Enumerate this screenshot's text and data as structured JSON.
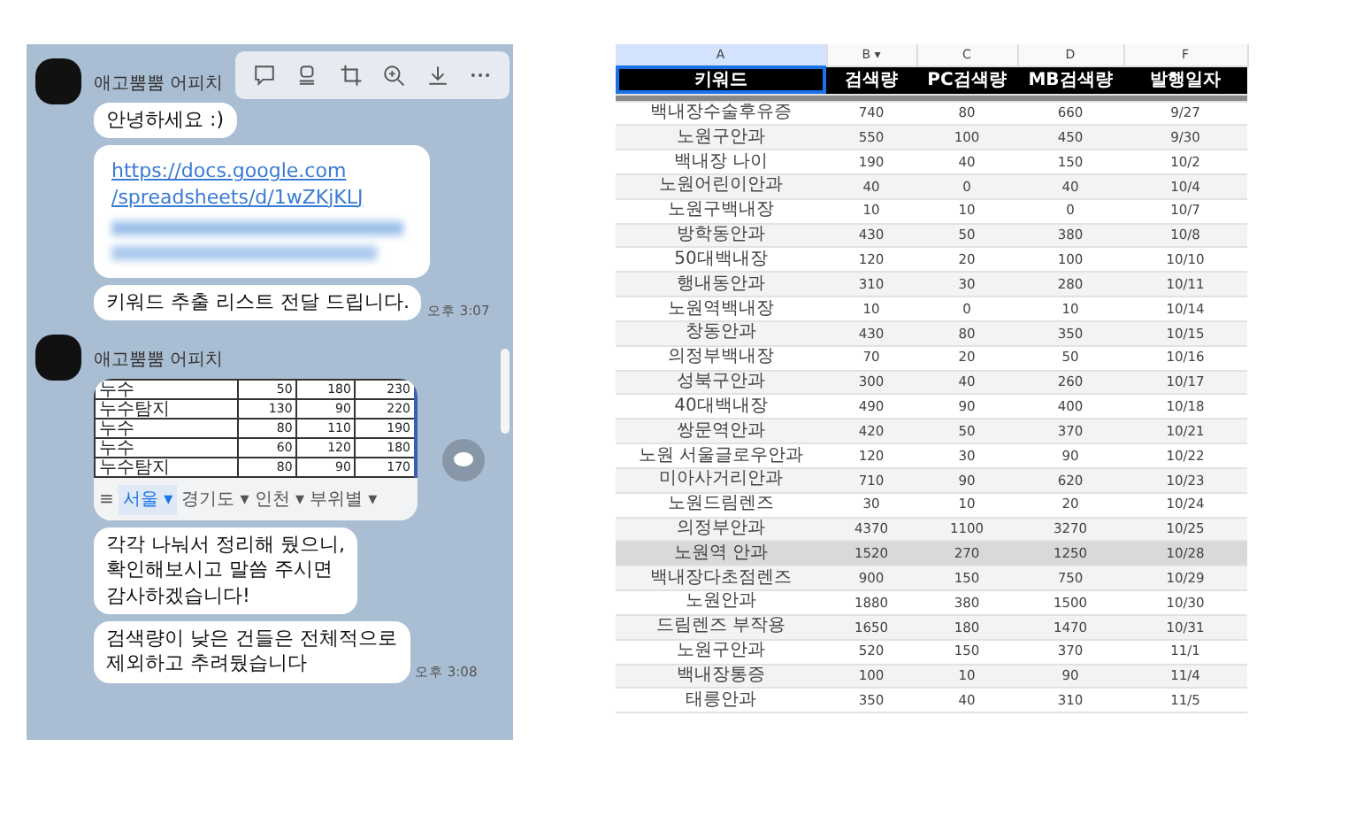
{
  "chat": {
    "groups": [
      {
        "sender": "애고뿜뿜 어피치",
        "items": [
          {
            "kind": "text",
            "text": "안녕하세요 :)"
          },
          {
            "kind": "link",
            "lines": [
              "https://docs.google.com",
              "/spreadsheets/d/1wZKjKLJ"
            ]
          },
          {
            "kind": "text",
            "text": "키워드 추출 리스트 전달 드립니다.",
            "time": "오후 3:07"
          }
        ]
      },
      {
        "sender": "애고뿜뿜 어피치",
        "items": [
          {
            "kind": "image",
            "rows": [
              {
                "cells": [
                  "누수",
                  "50",
                  "180",
                  "230"
                ]
              },
              {
                "cells": [
                  "누수탐지",
                  "130",
                  "90",
                  "220"
                ]
              },
              {
                "cells": [
                  "누수",
                  "80",
                  "110",
                  "190"
                ]
              },
              {
                "cells": [
                  "누수",
                  "60",
                  "120",
                  "180"
                ]
              },
              {
                "cells": [
                  "누수탐지",
                  "80",
                  "90",
                  "170"
                ]
              }
            ],
            "menu": "≡",
            "tabs": [
              {
                "label": "서울 ▾",
                "selected": true
              },
              {
                "label": "경기도 ▾",
                "selected": false
              },
              {
                "label": "인천 ▾",
                "selected": false
              },
              {
                "label": "부위별 ▾",
                "selected": false
              }
            ]
          },
          {
            "kind": "text",
            "text": "각각 나눠서 정리해 뒀으니,\n확인해보시고 말씀 주시면\n감사하겠습니다!"
          },
          {
            "kind": "text",
            "text": "검색량이 낮은 건들은 전체적으로\n제외하고 추려뒀습니다",
            "time": "오후 3:08"
          }
        ]
      }
    ]
  },
  "sheet": {
    "columns": [
      {
        "letter": "A",
        "selected": true
      },
      {
        "letter": "B",
        "selected": false,
        "filter_icon": "▾"
      },
      {
        "letter": "C",
        "selected": false
      },
      {
        "letter": "D",
        "selected": false
      },
      {
        "letter": "F",
        "selected": false
      }
    ],
    "headers": [
      "키워드",
      "검색량",
      "PC검색량",
      "MB검색량",
      "발행일자"
    ],
    "rows": [
      {
        "cells": [
          "백내장수술후유증",
          "740",
          "80",
          "660",
          "9/27"
        ],
        "selected": false
      },
      {
        "cells": [
          "노원구안과",
          "550",
          "100",
          "450",
          "9/30"
        ],
        "selected": false
      },
      {
        "cells": [
          "백내장 나이",
          "190",
          "40",
          "150",
          "10/2"
        ],
        "selected": false
      },
      {
        "cells": [
          "노원어린이안과",
          "40",
          "0",
          "40",
          "10/4"
        ],
        "selected": false
      },
      {
        "cells": [
          "노원구백내장",
          "10",
          "10",
          "0",
          "10/7"
        ],
        "selected": false
      },
      {
        "cells": [
          "방학동안과",
          "430",
          "50",
          "380",
          "10/8"
        ],
        "selected": false
      },
      {
        "cells": [
          "50대백내장",
          "120",
          "20",
          "100",
          "10/10"
        ],
        "selected": false
      },
      {
        "cells": [
          "행내동안과",
          "310",
          "30",
          "280",
          "10/11"
        ],
        "selected": false
      },
      {
        "cells": [
          "노원역백내장",
          "10",
          "0",
          "10",
          "10/14"
        ],
        "selected": false
      },
      {
        "cells": [
          "창동안과",
          "430",
          "80",
          "350",
          "10/15"
        ],
        "selected": false
      },
      {
        "cells": [
          "의정부백내장",
          "70",
          "20",
          "50",
          "10/16"
        ],
        "selected": false
      },
      {
        "cells": [
          "성북구안과",
          "300",
          "40",
          "260",
          "10/17"
        ],
        "selected": false
      },
      {
        "cells": [
          "40대백내장",
          "490",
          "90",
          "400",
          "10/18"
        ],
        "selected": false
      },
      {
        "cells": [
          "쌍문역안과",
          "420",
          "50",
          "370",
          "10/21"
        ],
        "selected": false
      },
      {
        "cells": [
          "노원 서울글로우안과",
          "120",
          "30",
          "90",
          "10/22"
        ],
        "selected": false
      },
      {
        "cells": [
          "미아사거리안과",
          "710",
          "90",
          "620",
          "10/23"
        ],
        "selected": false
      },
      {
        "cells": [
          "노원드림렌즈",
          "30",
          "10",
          "20",
          "10/24"
        ],
        "selected": false
      },
      {
        "cells": [
          "의정부안과",
          "4370",
          "1100",
          "3270",
          "10/25"
        ],
        "selected": false
      },
      {
        "cells": [
          "노원역 안과",
          "1520",
          "270",
          "1250",
          "10/28"
        ],
        "selected": true
      },
      {
        "cells": [
          "백내장다초점렌즈",
          "900",
          "150",
          "750",
          "10/29"
        ],
        "selected": false
      },
      {
        "cells": [
          "노원안과",
          "1880",
          "380",
          "1500",
          "10/30"
        ],
        "selected": false
      },
      {
        "cells": [
          "드림렌즈 부작용",
          "1650",
          "180",
          "1470",
          "10/31"
        ],
        "selected": false
      },
      {
        "cells": [
          "노원구안과",
          "520",
          "150",
          "370",
          "11/1"
        ],
        "selected": false
      },
      {
        "cells": [
          "백내장통증",
          "100",
          "10",
          "90",
          "11/4"
        ],
        "selected": false
      },
      {
        "cells": [
          "태릉안과",
          "350",
          "40",
          "310",
          "11/5"
        ],
        "selected": false
      }
    ]
  }
}
